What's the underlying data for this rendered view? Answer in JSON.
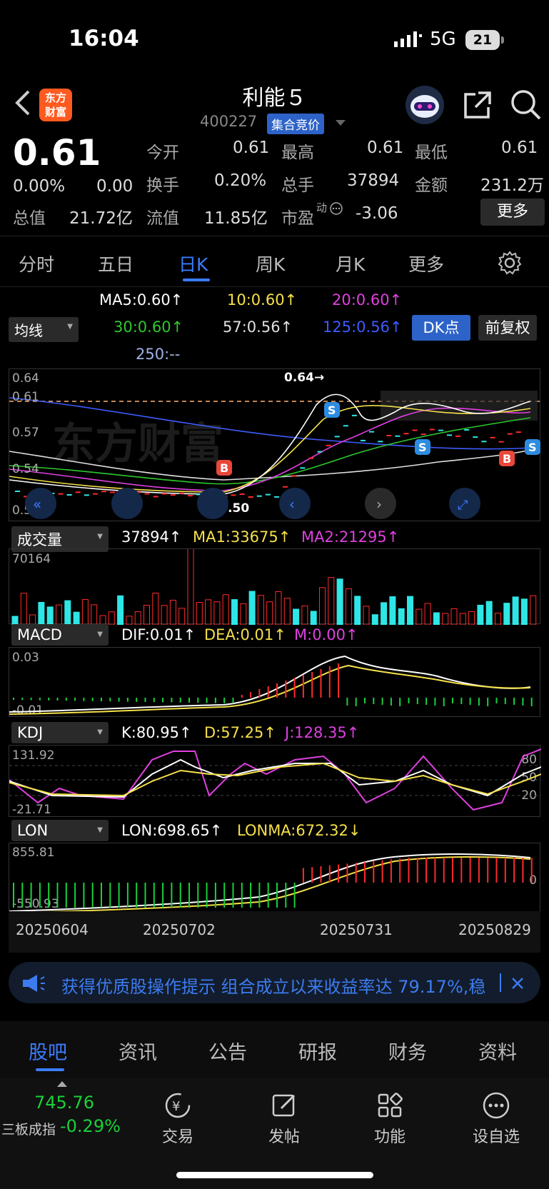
{
  "status_bar": {
    "time": "16:04",
    "network": "5G",
    "battery": "21"
  },
  "header": {
    "title": "利能５",
    "code": "400227",
    "badge": "集合竞价",
    "logo": "东方\n财富",
    "icons": [
      "back-icon",
      "robot-avatar",
      "share-icon",
      "search-icon"
    ]
  },
  "quote": {
    "price": "0.61",
    "change_pct": "0.00%",
    "change": "0.00",
    "open_label": "今开",
    "open": "0.61",
    "high_label": "最高",
    "high": "0.61",
    "low_label": "最低",
    "low": "0.61",
    "turnover_label": "换手",
    "turnover": "0.20%",
    "volume_label": "总手",
    "volume": "37894",
    "amount_label": "金额",
    "amount": "231.2万",
    "mcap_label": "总值",
    "mcap": "21.72亿",
    "float_label": "流值",
    "float_cap": "11.85亿",
    "pe_label": "市盈",
    "pe_tag": "动",
    "pe": "-3.06",
    "more_label": "更多"
  },
  "tabs": [
    "分时",
    "五日",
    "日K",
    "周K",
    "月K",
    "更多"
  ],
  "active_tab": "日K",
  "ma_legend": {
    "selector": "均线",
    "ma5": "MA5:0.60↑",
    "ma10": "10:0.60↑",
    "ma20": "20:0.60↑",
    "ma30": "30:0.60↑",
    "ma57": "57:0.56↑",
    "ma125": "125:0.56↑",
    "ma250": "250:--",
    "dk_button": "DK点",
    "adjust_button": "前复权"
  },
  "kline": {
    "y_labels": [
      "0.64",
      "0.61",
      "0.57",
      "0.54",
      "0.50"
    ],
    "high_marker": "0.64→",
    "low_marker": "←0.50",
    "watermark": "东方财富"
  },
  "volume": {
    "selector": "成交量",
    "value": "37894↑",
    "ma1": "MA1:33675↑",
    "ma2": "MA2:21295↑",
    "y_max": "70164"
  },
  "macd": {
    "selector": "MACD",
    "dif": "DIF:0.01↑",
    "dea": "DEA:0.01↑",
    "m": "M:0.00↑",
    "y_top": "0.03",
    "y_bottom": "-0.01"
  },
  "kdj": {
    "selector": "KDJ",
    "k": "K:80.95↑",
    "d": "D:57.25↑",
    "j": "J:128.35↑",
    "y_top": "131.92",
    "y_bottom": "-21.71",
    "levels": [
      "80",
      "50",
      "20"
    ]
  },
  "lon": {
    "selector": "LON",
    "lon": "LON:698.65↑",
    "lonma": "LONMA:672.32↓",
    "y_top": "855.81",
    "y_bottom": "-550.93",
    "zero": "0"
  },
  "dates": [
    "20250604",
    "20250702",
    "20250731",
    "20250829"
  ],
  "banner": {
    "text": "获得优质股操作提示 组合成立以来收益率达 79.17%,稳"
  },
  "bottom_tabs": [
    "股吧",
    "资讯",
    "公告",
    "研报",
    "财务",
    "资料"
  ],
  "dock": {
    "index_value": "745.76",
    "index_name": "三板成指",
    "index_change": "-0.29%",
    "items": [
      "交易",
      "发帖",
      "功能",
      "设自选"
    ]
  },
  "colors": {
    "accent": "#3b7cff",
    "up": "#ff2a2a",
    "down": "#2ee6e6",
    "ma5": "#ffffff",
    "ma10": "#f5e04a",
    "ma20": "#e040e0",
    "ma30": "#2ec82e",
    "ma125": "#3d5cff",
    "green": "#19d13a"
  }
}
